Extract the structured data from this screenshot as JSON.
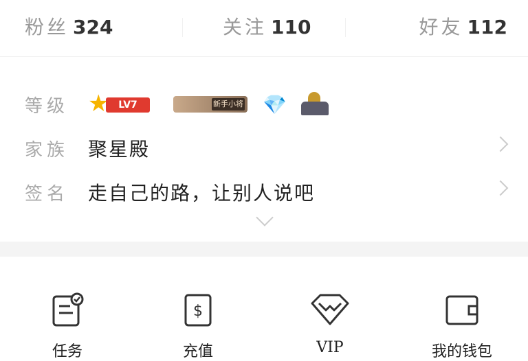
{
  "stats": [
    {
      "label": "粉丝",
      "value": "324"
    },
    {
      "label": "关注",
      "value": "110"
    },
    {
      "label": "好友",
      "value": "112"
    }
  ],
  "info": {
    "level": {
      "label": "等级",
      "level_badge_text": "LV7",
      "rank_badge_text": "新手小将"
    },
    "family": {
      "label": "家族",
      "value": "聚星殿"
    },
    "signature": {
      "label": "签名",
      "value": "走自己的路，让别人说吧"
    }
  },
  "grid": [
    {
      "icon": "task-icon",
      "label": "任务"
    },
    {
      "icon": "recharge-icon",
      "label": "充值"
    },
    {
      "icon": "vip-diamond-icon",
      "label": "VIP"
    },
    {
      "icon": "wallet-icon",
      "label": "我的钱包"
    }
  ],
  "colors": {
    "accent_red": "#e03a2f",
    "star_gold": "#f6b400",
    "divider": "#f4f4f4"
  }
}
